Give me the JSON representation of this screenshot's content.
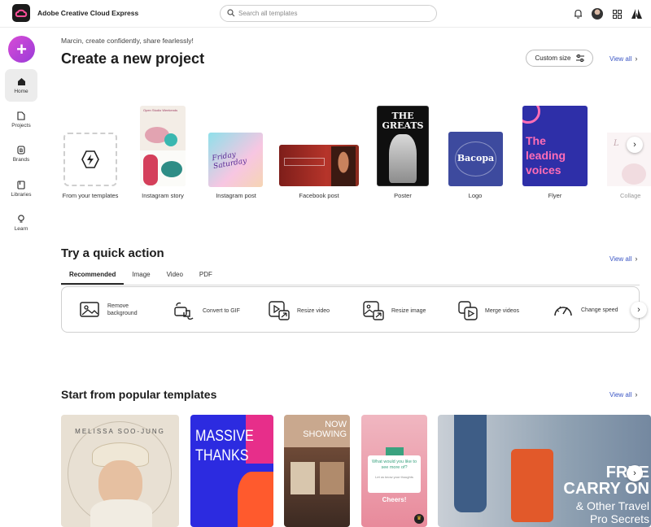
{
  "app": {
    "title": "Adobe Creative Cloud Express"
  },
  "search": {
    "placeholder": "Search all templates"
  },
  "sidebar": {
    "items": [
      {
        "label": "Home",
        "icon": "home-icon"
      },
      {
        "label": "Projects",
        "icon": "projects-icon"
      },
      {
        "label": "Brands",
        "icon": "brands-icon"
      },
      {
        "label": "Libraries",
        "icon": "libraries-icon"
      },
      {
        "label": "Learn",
        "icon": "learn-icon"
      }
    ]
  },
  "greeting": "Marcin, create confidently, share fearlessly!",
  "create": {
    "heading": "Create a new project",
    "custom_size": "Custom size",
    "view_all": "View all",
    "items": [
      {
        "label": "From your templates"
      },
      {
        "label": "Instagram story",
        "text": "Open Studio Weekends"
      },
      {
        "label": "Instagram post",
        "text": "Friday Saturday"
      },
      {
        "label": "Facebook post"
      },
      {
        "label": "Poster",
        "text": "THE GREATS"
      },
      {
        "label": "Logo",
        "text": "Bacopa"
      },
      {
        "label": "Flyer",
        "text": "The leading voices"
      },
      {
        "label": "Collage"
      }
    ]
  },
  "quick": {
    "heading": "Try a quick action",
    "view_all": "View all",
    "tabs": [
      "Recommended",
      "Image",
      "Video",
      "PDF"
    ],
    "actions": [
      {
        "label": "Remove background",
        "line1": "Remove",
        "line2": "background",
        "icon": "remove-background-icon"
      },
      {
        "label": "Convert to GIF",
        "icon": "convert-gif-icon"
      },
      {
        "label": "Resize video",
        "icon": "resize-video-icon"
      },
      {
        "label": "Resize image",
        "icon": "resize-image-icon"
      },
      {
        "label": "Merge videos",
        "icon": "merge-videos-icon"
      },
      {
        "label": "Change speed",
        "icon": "change-speed-icon"
      }
    ]
  },
  "popular": {
    "heading": "Start from popular templates",
    "view_all": "View all",
    "templates": [
      {
        "name": "melissa-soo-jung",
        "text": "MELISSA SOO-JUNG"
      },
      {
        "name": "massive-thanks",
        "text1": "MASSIVE",
        "text2": "THANKS"
      },
      {
        "name": "now-showing",
        "text1": "NOW",
        "text2": "SHOWING"
      },
      {
        "name": "what-would-you-like",
        "text": "What would you like to see more of?",
        "sub": "Let us know your thoughts",
        "cheers": "Cheers!"
      },
      {
        "name": "free-carry-on",
        "text1": "FREE",
        "text2": "CARRY ON",
        "text3": "& Other Travel",
        "text4": "Pro Secrets"
      }
    ]
  },
  "colors": {
    "accent": "#3a55c4",
    "fab_start": "#d84cd6",
    "fab_end": "#9a3bd8"
  }
}
